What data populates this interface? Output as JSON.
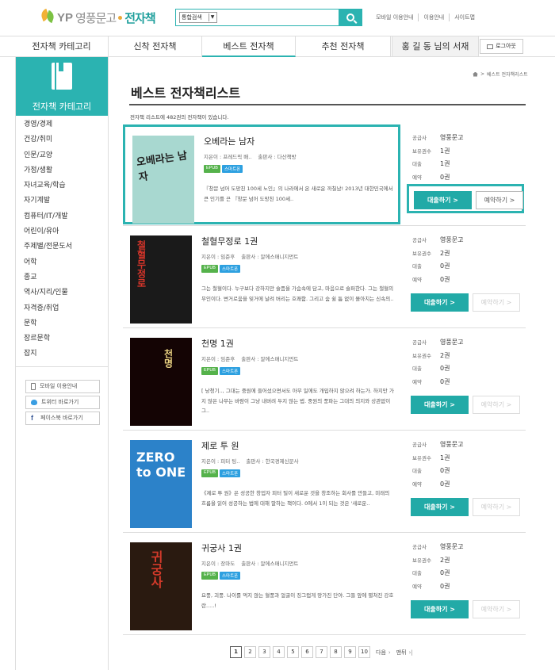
{
  "header": {
    "logo_yp": "YP",
    "logo_name": "영풍문고",
    "logo_sub": "전자책",
    "search_scope": "통합검색",
    "util_links": [
      "모바일 이용안내",
      "이용안내",
      "사이트맵"
    ]
  },
  "gnb": {
    "items": [
      "전자책 카테고리",
      "신착 전자책",
      "베스트 전자책",
      "추천 전자책"
    ],
    "library": "홍 길 동 님의 서재",
    "logout": "로그아웃"
  },
  "sidebar": {
    "title": "전자책 카테고리",
    "categories": [
      "경영/경제",
      "건강/취미",
      "인문/교양",
      "가정/생활",
      "자녀교육/학습",
      "자기계발",
      "컴퓨터/IT/개발",
      "어린이/유아",
      "주제별/전문도서",
      "어학",
      "종교",
      "역사/지리/인물",
      "자격증/취업",
      "문학",
      "장르문학",
      "잡지"
    ],
    "buttons": [
      "모바일 이용안내",
      "트위터 바로가기",
      "페이스북 바로가기"
    ]
  },
  "breadcrumb": "베스트 전자책리스트",
  "page_title": "베스트 전자책리스트",
  "count_text": "전자책 리스트에 482권의 전자책이 있습니다.",
  "labels": {
    "supplier": "공급사",
    "owned": "보유권수",
    "loaned": "대출",
    "reserved": "예약",
    "author_prefix": "지은이 :",
    "publisher_prefix": "출판사 :",
    "badge_epub": "EPUB",
    "badge_smart": "스마트폰",
    "loan_btn": "대출하기",
    "reserve_btn": "예약하기"
  },
  "books": [
    {
      "title": "오베라는 남자",
      "author": "프레드릭 배..",
      "publisher": "다산책방",
      "desc": "『창문 넘어 도망친 100세 노인』의 나라에서 온 새로운 까칠남! 2013년 대한민국에서 큰 인기를 끈 『창문 넘어 도망친 100세..",
      "supplier": "영풍문고",
      "owned": "1권",
      "loaned": "1권",
      "reserved": "0권",
      "cover_text": "오베라는 남자",
      "reserve_enabled": true
    },
    {
      "title": "철혈무정로 1권",
      "author": "임준후",
      "publisher": "알에스매니지먼트",
      "desc": "그는 철혈이다. 누구보다 강하지만 슬픔을 가슴속에 담고, 마음으로 슬퍼한다. 그는 철혈의 무인이다. 변거로움을 잊거에 날려 버리는 호쾌함. 그리고 숨 쉴 틈 없이 몰아치는 신속의..",
      "supplier": "영풍문고",
      "owned": "2권",
      "loaned": "0권",
      "reserved": "0권",
      "cover_text": "철혈무정로",
      "reserve_enabled": false
    },
    {
      "title": "천명 1권",
      "author": "임준후",
      "publisher": "알에스매니지먼트",
      "desc": "[ 낭청기.., 그대는 중원에 들어섰으면서도 아무 일에도 개입하지 않으려 하는가. 하지만 가지 않은 나무는 바람이 그냥 내버려 두지 않는 법. 중원의 풍파는 그대의 의지와 상관없이 그..",
      "supplier": "영풍문고",
      "owned": "2권",
      "loaned": "0권",
      "reserved": "0권",
      "cover_text": "천명",
      "reserve_enabled": false
    },
    {
      "title": "제로 투 원",
      "author": "피터 팅..",
      "publisher": "한국경제신문사",
      "desc": "《제로 투 원》은 성공한 창업자 피터 틸이 새로운 것을 창조하는 회사를 만들고, 미래의 흐름을 읽어 성공하는 법에 대해 말하는 책이다. 0에서 1이 되는 것은 '새로운..",
      "supplier": "영풍문고",
      "owned": "1권",
      "loaned": "0권",
      "reserved": "0권",
      "cover_text": "ZERO to ONE",
      "reserve_enabled": false
    },
    {
      "title": "귀궁사 1권",
      "author": "장마도",
      "publisher": "알에스매니지먼트",
      "desc": "요풍, 괴풍. 나이를 먹지 않는 혈풍과 얼굴이 징그럽게 망가진 단야. 그들 앞에 펼쳐진 강호란.....!",
      "supplier": "영풍문고",
      "owned": "2권",
      "loaned": "0권",
      "reserved": "0권",
      "cover_text": "귀궁사",
      "reserve_enabled": false
    }
  ],
  "pager": {
    "pages": [
      "1",
      "2",
      "3",
      "4",
      "5",
      "6",
      "7",
      "8",
      "9",
      "10"
    ],
    "next": "다음",
    "last": "맨뒤"
  }
}
